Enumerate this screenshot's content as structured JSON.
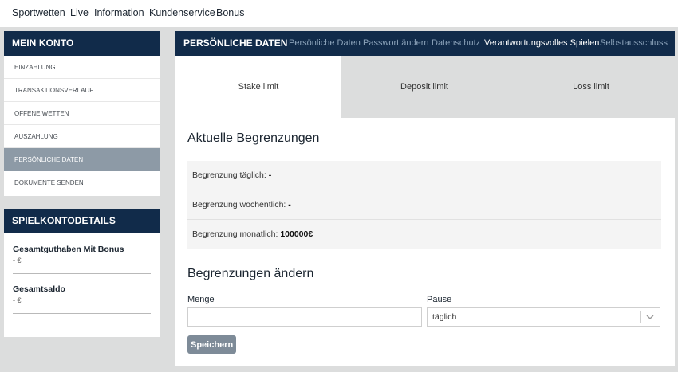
{
  "topnav": {
    "items": [
      "Sportwetten",
      "Live",
      "Information",
      "Kundenservice",
      "Bonus"
    ]
  },
  "sidebar": {
    "account_title": "MEIN KONTO",
    "items": [
      {
        "label": "EINZAHLUNG"
      },
      {
        "label": "TRANSAKTIONSVERLAUF"
      },
      {
        "label": "OFFENE WETTEN"
      },
      {
        "label": "AUSZAHLUNG"
      },
      {
        "label": "PERSÖNLICHE DATEN",
        "active": true
      },
      {
        "label": "DOKUMENTE SENDEN"
      }
    ],
    "details_title": "SPIELKONTODETAILS",
    "details": [
      {
        "label": "Gesamtguthaben Mit Bonus",
        "value": "- €"
      },
      {
        "label": "Gesamtsaldo",
        "value": "- €"
      }
    ]
  },
  "main": {
    "title": "PERSÖNLICHE DATEN",
    "subtabs": [
      {
        "label": "Persönliche Daten"
      },
      {
        "label": "Passwort ändern"
      },
      {
        "label": "Datenschutz"
      },
      {
        "label": "Verantwortungsvolles Spielen",
        "active": true
      },
      {
        "label": "Selbstausschluss"
      }
    ],
    "tabs": [
      {
        "label": "Stake limit",
        "active": true
      },
      {
        "label": "Deposit limit"
      },
      {
        "label": "Loss limit"
      }
    ],
    "current_title": "Aktuelle Begrenzungen",
    "limits": [
      {
        "label": "Begrenzung täglich:",
        "value": "-"
      },
      {
        "label": "Begrenzung wöchentlich:",
        "value": "-"
      },
      {
        "label": "Begrenzung monatlich:",
        "value": "100000€"
      }
    ],
    "change_title": "Begrenzungen ändern",
    "form": {
      "amount_label": "Menge",
      "amount_value": "",
      "pause_label": "Pause",
      "pause_value": "täglich",
      "save_label": "Speichern"
    }
  }
}
